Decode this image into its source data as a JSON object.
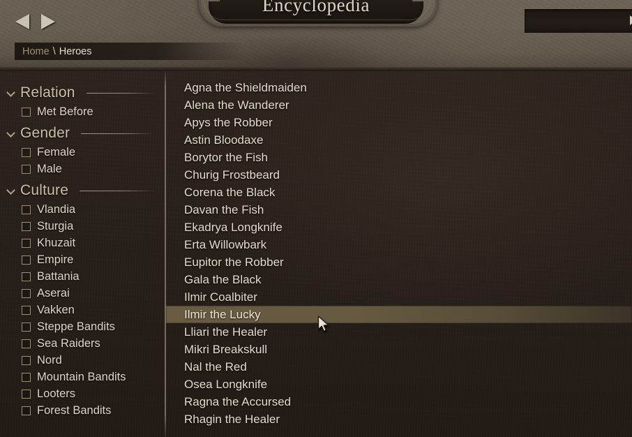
{
  "header": {
    "title": "Encyclopedia",
    "nav": {
      "back_icon": "arrow-left-icon",
      "forward_icon": "arrow-right-icon"
    },
    "breadcrumb": {
      "home": "Home",
      "separator": "\\",
      "current": "Heroes"
    },
    "search": {
      "value": "",
      "placeholder": ""
    }
  },
  "sidebar": {
    "groups": [
      {
        "label": "Relation",
        "expanded": true,
        "options": [
          {
            "label": "Met Before",
            "checked": false
          }
        ]
      },
      {
        "label": "Gender",
        "expanded": true,
        "options": [
          {
            "label": "Female",
            "checked": false
          },
          {
            "label": "Male",
            "checked": false
          }
        ]
      },
      {
        "label": "Culture",
        "expanded": true,
        "options": [
          {
            "label": "Vlandia",
            "checked": false
          },
          {
            "label": "Sturgia",
            "checked": false
          },
          {
            "label": "Khuzait",
            "checked": false
          },
          {
            "label": "Empire",
            "checked": false
          },
          {
            "label": "Battania",
            "checked": false
          },
          {
            "label": "Aserai",
            "checked": false
          },
          {
            "label": "Vakken",
            "checked": false
          },
          {
            "label": "Steppe Bandits",
            "checked": false
          },
          {
            "label": "Sea Raiders",
            "checked": false
          },
          {
            "label": "Nord",
            "checked": false
          },
          {
            "label": "Mountain Bandits",
            "checked": false
          },
          {
            "label": "Looters",
            "checked": false
          },
          {
            "label": "Forest Bandits",
            "checked": false
          }
        ]
      }
    ]
  },
  "list": {
    "selected_index": 13,
    "items": [
      {
        "name": "Agna the Shieldmaiden"
      },
      {
        "name": "Alena the Wanderer"
      },
      {
        "name": "Apys the Robber"
      },
      {
        "name": "Astin Bloodaxe"
      },
      {
        "name": "Borytor the Fish"
      },
      {
        "name": "Churig Frostbeard"
      },
      {
        "name": "Corena the Black"
      },
      {
        "name": "Davan the Fish"
      },
      {
        "name": "Ekadrya Longknife"
      },
      {
        "name": "Erta Willowbark"
      },
      {
        "name": "Eupitor the Robber"
      },
      {
        "name": "Gala the Black"
      },
      {
        "name": "Ilmir Coalbiter"
      },
      {
        "name": "Ilmir the Lucky"
      },
      {
        "name": "Lliari the Healer"
      },
      {
        "name": "Mikri Breakskull"
      },
      {
        "name": "Nal the Red"
      },
      {
        "name": "Osea Longknife"
      },
      {
        "name": "Ragna the Accursed"
      },
      {
        "name": "Rhagin the Healer"
      }
    ]
  },
  "colors": {
    "accent": "#cbbfa6",
    "text": "#e3dbcc",
    "muted": "#9c8f76",
    "selection": "#6a5c42",
    "panel_bg": "#2c241d",
    "header_bg": "#6e6457"
  }
}
